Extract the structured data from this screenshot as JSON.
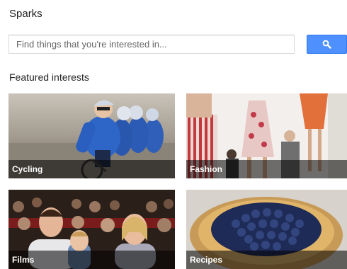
{
  "page": {
    "title": "Sparks"
  },
  "search": {
    "placeholder": "Find things that you're interested in...",
    "button_icon": "search-icon",
    "accent_color": "#4d90fe"
  },
  "featured": {
    "heading": "Featured interests",
    "tiles": [
      {
        "label": "Cycling"
      },
      {
        "label": "Fashion"
      },
      {
        "label": "Films"
      },
      {
        "label": "Recipes"
      }
    ]
  }
}
